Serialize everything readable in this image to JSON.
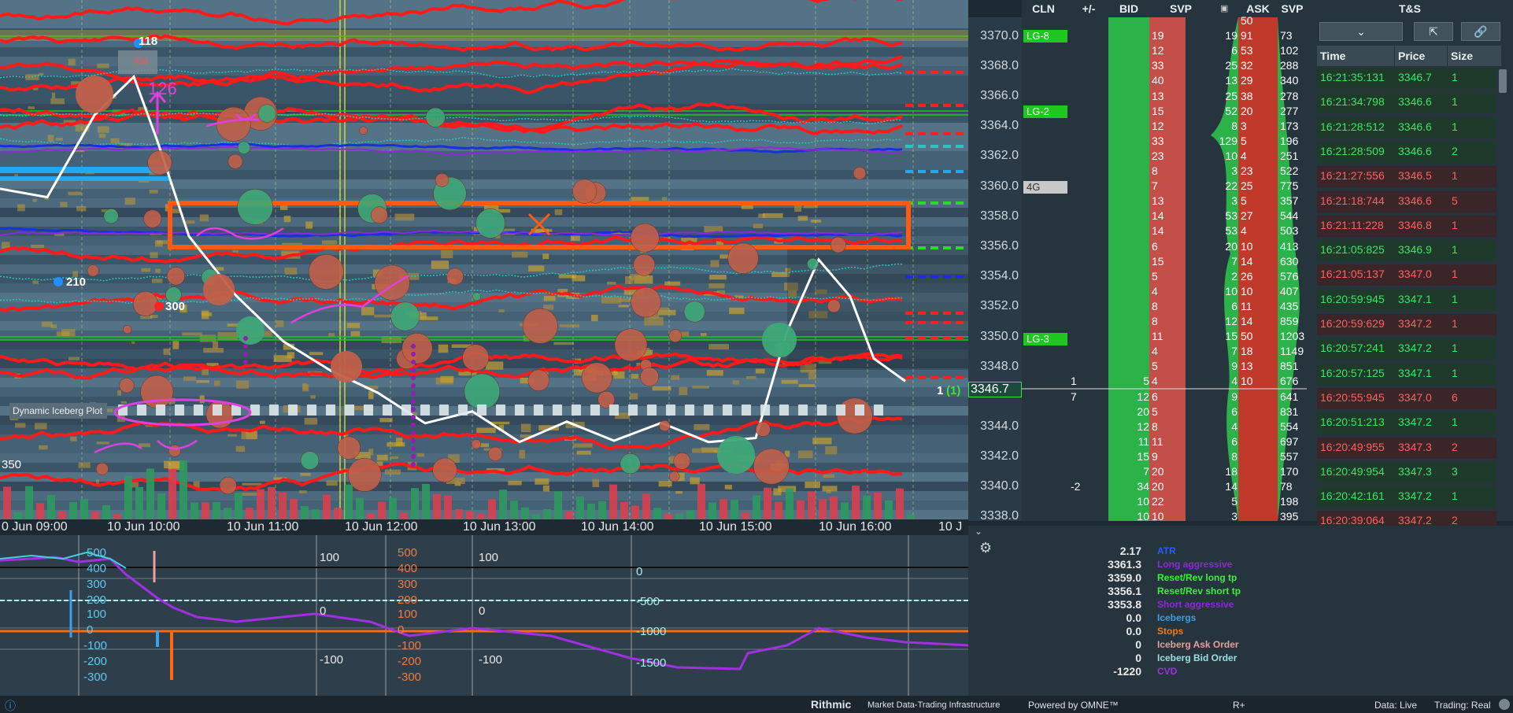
{
  "price_axis": {
    "ticks": [
      "3370.0",
      "3368.0",
      "3366.0",
      "3364.0",
      "3362.0",
      "3360.0",
      "3358.0",
      "3356.0",
      "3354.0",
      "3352.0",
      "3350.0",
      "3348.0",
      "3346.7",
      "3344.0",
      "3342.0",
      "3340.0",
      "3338.0"
    ],
    "level_tags": [
      {
        "label": "LG-8",
        "price": "3370.0",
        "color": "#1ec81e"
      },
      {
        "label": "LG-2",
        "price": "3365.0",
        "color": "#1ec81e"
      },
      {
        "label": "4G",
        "price": "3360.0",
        "color": "#c8c8c8"
      },
      {
        "label": "LG-3",
        "price": "3350.0",
        "color": "#1ec81e"
      }
    ]
  },
  "chart": {
    "x_labels": [
      "0 Jun 09:00",
      "10 Jun 10:00",
      "10 Jun 11:00",
      "10 Jun 12:00",
      "10 Jun 13:00",
      "10 Jun 14:00",
      "10 Jun 15:00",
      "10 Jun 16:00",
      "10 J"
    ],
    "markers": {
      "m118": "118",
      "m200": "200",
      "m126": "126",
      "m210": "210",
      "m300": "300",
      "m350": "350"
    },
    "iceberg_label": "Dynamic Iceberg Plot",
    "position_label": "1",
    "position_count": "(1)"
  },
  "ladder": {
    "headers": [
      "CLN",
      "+/-",
      "BID",
      "SVP",
      "ASK",
      "SVP"
    ],
    "svp_icon": "calendar-icon",
    "rows": [
      {
        "bid": "",
        "sv1": "",
        "sv1b": "",
        "ask": "50",
        "svp": ""
      },
      {
        "bid": "",
        "sv1": "19",
        "sv1b": "19",
        "ask": "91",
        "svp": "73"
      },
      {
        "bid": "",
        "sv1": "12",
        "sv1b": "6",
        "ask": "53",
        "svp": "102"
      },
      {
        "bid": "",
        "sv1": "33",
        "sv1b": "25",
        "ask": "32",
        "svp": "288"
      },
      {
        "bid": "",
        "sv1": "40",
        "sv1b": "13",
        "ask": "29",
        "svp": "340"
      },
      {
        "bid": "",
        "sv1": "13",
        "sv1b": "25",
        "ask": "38",
        "svp": "278"
      },
      {
        "bid": "",
        "sv1": "15",
        "sv1b": "52",
        "ask": "20",
        "svp": "277"
      },
      {
        "bid": "",
        "sv1": "12",
        "sv1b": "8",
        "ask": "3",
        "svp": "173"
      },
      {
        "bid": "",
        "sv1": "33",
        "sv1b": "129",
        "ask": "5",
        "svp": "196"
      },
      {
        "bid": "",
        "sv1": "23",
        "sv1b": "10",
        "ask": "4",
        "svp": "251"
      },
      {
        "bid": "",
        "sv1": "8",
        "sv1b": "3",
        "ask": "23",
        "svp": "522"
      },
      {
        "bid": "",
        "sv1": "7",
        "sv1b": "22",
        "ask": "25",
        "svp": "775"
      },
      {
        "bid": "",
        "sv1": "13",
        "sv1b": "3",
        "ask": "5",
        "svp": "357"
      },
      {
        "bid": "",
        "sv1": "14",
        "sv1b": "53",
        "ask": "27",
        "svp": "544"
      },
      {
        "bid": "",
        "sv1": "14",
        "sv1b": "53",
        "ask": "4",
        "svp": "503"
      },
      {
        "bid": "",
        "sv1": "6",
        "sv1b": "20",
        "ask": "10",
        "svp": "413"
      },
      {
        "bid": "",
        "sv1": "15",
        "sv1b": "7",
        "ask": "14",
        "svp": "630"
      },
      {
        "bid": "",
        "sv1": "5",
        "sv1b": "2",
        "ask": "26",
        "svp": "576"
      },
      {
        "bid": "",
        "sv1": "4",
        "sv1b": "10",
        "ask": "10",
        "svp": "407"
      },
      {
        "bid": "",
        "sv1": "8",
        "sv1b": "6",
        "ask": "11",
        "svp": "435"
      },
      {
        "bid": "",
        "sv1": "8",
        "sv1b": "12",
        "ask": "14",
        "svp": "859"
      },
      {
        "bid": "",
        "sv1": "11",
        "sv1b": "15",
        "ask": "50",
        "svp": "1203"
      },
      {
        "bid": "",
        "sv1": "4",
        "sv1b": "7",
        "ask": "18",
        "svp": "1149"
      },
      {
        "bid": "",
        "sv1": "5",
        "sv1b": "9",
        "ask": "13",
        "svp": "851"
      },
      {
        "bid": "5",
        "sv1": "4",
        "sv1b": "4",
        "ask": "10",
        "svp": "676"
      },
      {
        "bid": "12",
        "sv1": "6",
        "sv1b": "9",
        "ask": "",
        "svp": "641"
      },
      {
        "bid": "20",
        "sv1": "5",
        "sv1b": "6",
        "ask": "",
        "svp": "831"
      },
      {
        "bid": "12",
        "sv1": "8",
        "sv1b": "4",
        "ask": "",
        "svp": "554"
      },
      {
        "bid": "11",
        "sv1": "11",
        "sv1b": "6",
        "ask": "",
        "svp": "697"
      },
      {
        "bid": "15",
        "sv1": "9",
        "sv1b": "8",
        "ask": "",
        "svp": "557"
      },
      {
        "bid": "7",
        "sv1": "20",
        "sv1b": "18",
        "ask": "",
        "svp": "170"
      },
      {
        "bid": "34",
        "sv1": "20",
        "sv1b": "14",
        "ask": "",
        "svp": "78"
      },
      {
        "bid": "10",
        "sv1": "22",
        "sv1b": "5",
        "ask": "",
        "svp": "198"
      },
      {
        "bid": "10",
        "sv1": "10",
        "sv1b": "3",
        "ask": "",
        "svp": "395"
      }
    ],
    "cln_values": [
      {
        "value": "1",
        "row": 24
      },
      {
        "value": "7",
        "row": 25
      },
      {
        "value": "-2",
        "row": 31
      }
    ]
  },
  "ts": {
    "title": "T&S",
    "buttons": [
      {
        "icon": "chevron-down-icon",
        "glyph": "⌄"
      },
      {
        "icon": "export-icon",
        "glyph": "⇱"
      },
      {
        "icon": "link-icon",
        "glyph": "🔗"
      }
    ],
    "headers": [
      "Time",
      "Price",
      "Size"
    ],
    "rows": [
      {
        "time": "16:21:35:131",
        "price": "3346.7",
        "size": "1",
        "side": "buy"
      },
      {
        "time": "16:21:34:798",
        "price": "3346.6",
        "size": "1",
        "side": "buy"
      },
      {
        "time": "16:21:28:512",
        "price": "3346.6",
        "size": "1",
        "side": "buy"
      },
      {
        "time": "16:21:28:509",
        "price": "3346.6",
        "size": "2",
        "side": "buy"
      },
      {
        "time": "16:21:27:556",
        "price": "3346.5",
        "size": "1",
        "side": "sell"
      },
      {
        "time": "16:21:18:744",
        "price": "3346.6",
        "size": "5",
        "side": "sell"
      },
      {
        "time": "16:21:11:228",
        "price": "3346.8",
        "size": "1",
        "side": "sell"
      },
      {
        "time": "16:21:05:825",
        "price": "3346.9",
        "size": "1",
        "side": "buy"
      },
      {
        "time": "16:21:05:137",
        "price": "3347.0",
        "size": "1",
        "side": "sell"
      },
      {
        "time": "16:20:59:945",
        "price": "3347.1",
        "size": "1",
        "side": "buy"
      },
      {
        "time": "16:20:59:629",
        "price": "3347.2",
        "size": "1",
        "side": "sell"
      },
      {
        "time": "16:20:57:241",
        "price": "3347.2",
        "size": "1",
        "side": "buy"
      },
      {
        "time": "16:20:57:125",
        "price": "3347.1",
        "size": "1",
        "side": "buy"
      },
      {
        "time": "16:20:55:945",
        "price": "3347.0",
        "size": "6",
        "side": "sell"
      },
      {
        "time": "16:20:51:213",
        "price": "3347.2",
        "size": "1",
        "side": "buy"
      },
      {
        "time": "16:20:49:955",
        "price": "3347.3",
        "size": "2",
        "side": "sell"
      },
      {
        "time": "16:20:49:954",
        "price": "3347.3",
        "size": "3",
        "side": "buy"
      },
      {
        "time": "16:20:42:161",
        "price": "3347.2",
        "size": "1",
        "side": "buy"
      },
      {
        "time": "16:20:39:064",
        "price": "3347.2",
        "size": "2",
        "side": "sell"
      }
    ]
  },
  "lower": {
    "y_labels": [
      {
        "text": "500",
        "color": "#5ec8f0"
      },
      {
        "text": "400",
        "color": "#5ec8f0"
      },
      {
        "text": "300",
        "color": "#5ec8f0"
      },
      {
        "text": "200",
        "color": "#5ec8f0"
      },
      {
        "text": "100",
        "color": "#5ec8f0"
      },
      {
        "text": "0",
        "color": "#5ec8f0"
      },
      {
        "text": "-100",
        "color": "#5ec8f0"
      },
      {
        "text": "-200",
        "color": "#5ec8f0"
      },
      {
        "text": "-300",
        "color": "#5ec8f0"
      }
    ],
    "mid_labels_1": [
      "100",
      "0",
      "-100"
    ],
    "mid_labels_2": [
      "500",
      "400",
      "300",
      "200",
      "100",
      "0",
      "-100",
      "-200",
      "-300"
    ],
    "mid_labels_3": [
      "100",
      "0",
      "-100"
    ],
    "right_labels": [
      "0",
      "-500",
      "-1000",
      "-1500"
    ]
  },
  "stats": {
    "rows": [
      {
        "value": "2.17",
        "label": "ATR",
        "color": "#2a5cff"
      },
      {
        "value": "3361.3",
        "label": "Long aggressive",
        "color": "#8a2ad8"
      },
      {
        "value": "3359.0",
        "label": "Reset/Rev long tp",
        "color": "#3bf03b"
      },
      {
        "value": "3356.1",
        "label": "Reset/Rev short tp",
        "color": "#3bf03b"
      },
      {
        "value": "3353.8",
        "label": "Short aggressive",
        "color": "#8a2ad8"
      },
      {
        "value": "0.0",
        "label": "Icebergs",
        "color": "#3aa0e8"
      },
      {
        "value": "0.0",
        "label": "Stops",
        "color": "#f07a1e"
      },
      {
        "value": "0",
        "label": "Iceberg Ask Order",
        "color": "#f09a9a"
      },
      {
        "value": "0",
        "label": "Iceberg Bid Order",
        "color": "#9ae0e0"
      },
      {
        "value": "-1220",
        "label": "CVD",
        "color": "#a030e0"
      }
    ]
  },
  "status": {
    "brand": "Rithmic",
    "tagline": "Market Data-Trading Infrastructure",
    "powered": "Powered by OMNE™",
    "rplus": "R+",
    "data": "Data: Live",
    "trading": "Trading: Real"
  }
}
